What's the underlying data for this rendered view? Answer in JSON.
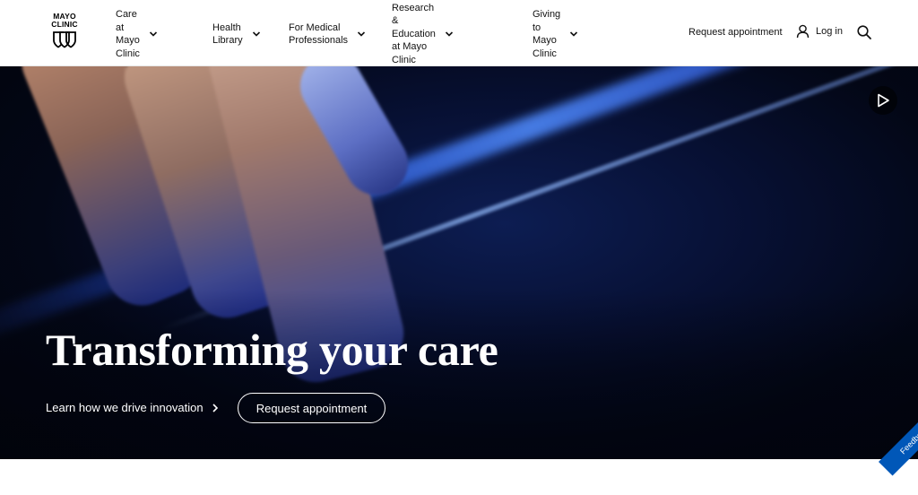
{
  "brand": {
    "logo_line1": "MAYO",
    "logo_line2": "CLINIC",
    "icon": "mayo-shields-logo"
  },
  "nav": {
    "items": [
      {
        "line1": "Care at",
        "line2": "Mayo Clinic",
        "icon": "chevron-down-icon"
      },
      {
        "line1": "Health",
        "line2": "Library",
        "icon": "chevron-down-icon"
      },
      {
        "line1": "For Medical",
        "line2": "Professionals",
        "icon": "chevron-down-icon"
      },
      {
        "line1": "Research & Education",
        "line2": "at Mayo Clinic",
        "icon": "chevron-down-icon"
      },
      {
        "line1": "Giving to",
        "line2": "Mayo Clinic",
        "icon": "chevron-down-icon"
      }
    ]
  },
  "header_right": {
    "request_label": "Request appointment",
    "login_label": "Log in",
    "login_icon": "user-icon",
    "search_icon": "search-icon"
  },
  "hero": {
    "title": "Transforming your care",
    "learn_link": "Learn how we drive innovation",
    "cta_label": "Request appointment",
    "play_icon": "play-icon"
  },
  "feedback": {
    "label": "Feedback"
  },
  "colors": {
    "accent": "#0057b8",
    "hero_bg": "#030716",
    "header_bg": "#ffffff"
  }
}
